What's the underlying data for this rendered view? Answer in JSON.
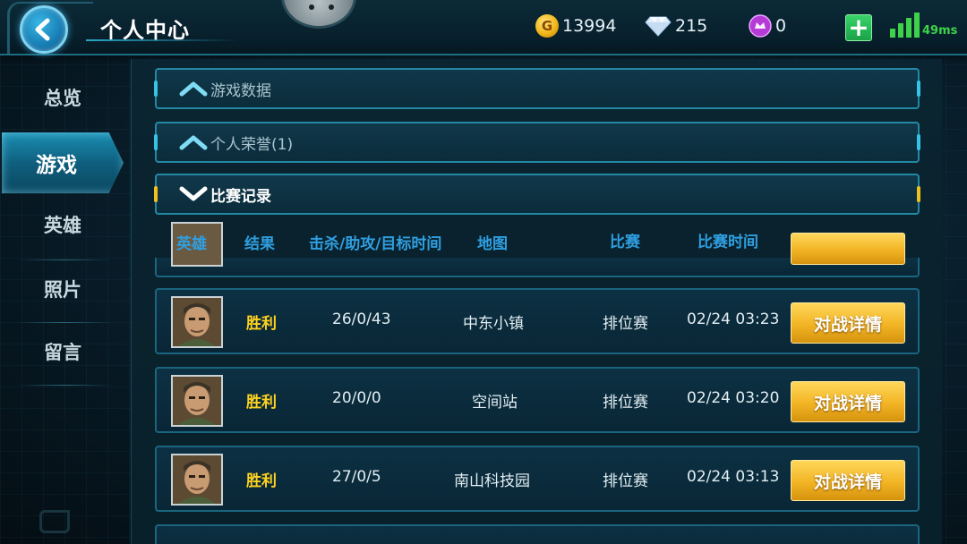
{
  "header": {
    "title": "个人中心",
    "gold": "13994",
    "diamonds": "215",
    "gems": "0",
    "ping": "49ms"
  },
  "sidebar": {
    "items": [
      {
        "label": "总览"
      },
      {
        "label": "游戏",
        "active": true
      },
      {
        "label": "英雄"
      },
      {
        "label": "照片"
      },
      {
        "label": "留言"
      }
    ]
  },
  "sections": [
    {
      "label": "游戏数据",
      "state": "collapsed"
    },
    {
      "label": "个人荣誉(1)",
      "state": "collapsed"
    },
    {
      "label": "比赛记录",
      "state": "expanded"
    }
  ],
  "table": {
    "headers": {
      "hero": "英雄",
      "result": "结果",
      "kda": "击杀/助攻/目标时间",
      "map": "地图",
      "mode": "比赛",
      "time": "比赛时间"
    },
    "rows": [
      {
        "result": "胜利",
        "kda": "26/0/43",
        "map": "中东小镇",
        "mode": "排位赛",
        "time": "02/24 03:23",
        "action": "对战详情"
      },
      {
        "result": "胜利",
        "kda": "20/0/0",
        "map": "空间站",
        "mode": "排位赛",
        "time": "02/24 03:20",
        "action": "对战详情"
      },
      {
        "result": "胜利",
        "kda": "27/0/5",
        "map": "南山科技园",
        "mode": "排位赛",
        "time": "02/24 03:13",
        "action": "对战详情"
      }
    ]
  },
  "colors": {
    "accent": "#2388a4",
    "result_win": "#ffd21e",
    "header_text": "#2f9fe0",
    "button_gold": "#f2b424"
  }
}
